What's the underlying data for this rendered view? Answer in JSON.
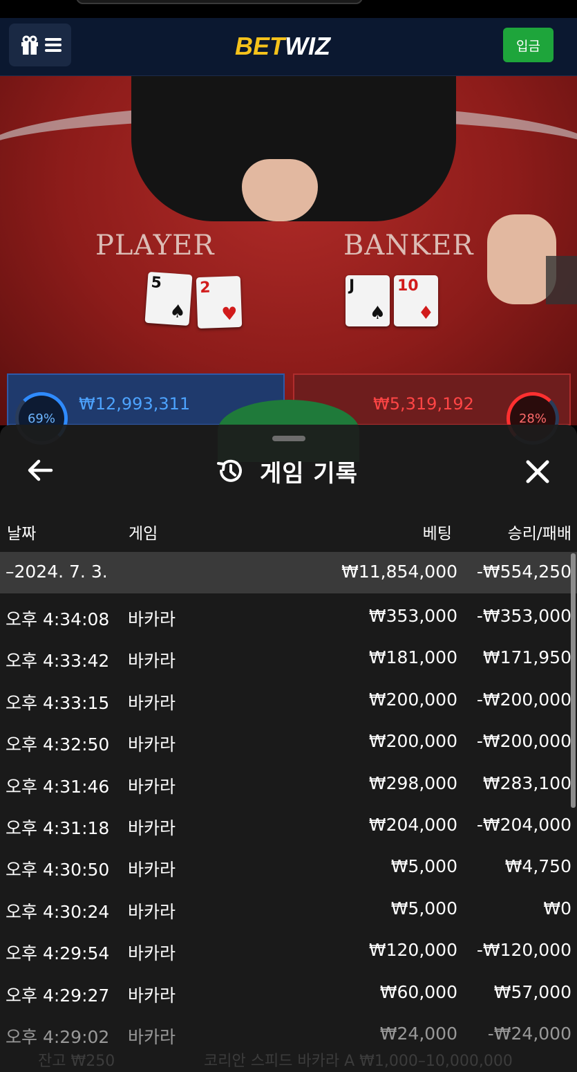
{
  "header": {
    "brand_part1": "BET",
    "brand_part2": "WIZ",
    "deposit_label": "입금"
  },
  "game": {
    "player_label": "PLAYER",
    "banker_label": "BANKER",
    "player_cards": [
      {
        "rank": "5",
        "suit": "♠",
        "color": "black"
      },
      {
        "rank": "2",
        "suit": "♥",
        "color": "red"
      }
    ],
    "banker_cards": [
      {
        "rank": "J",
        "suit": "♠",
        "color": "black"
      },
      {
        "rank": "10",
        "suit": "♦",
        "color": "red"
      }
    ],
    "player_percent": "69%",
    "banker_percent": "28%",
    "player_amount": "₩12,993,311",
    "banker_amount": "₩5,319,192"
  },
  "history": {
    "title": "게임 기록",
    "columns": {
      "date": "날짜",
      "game": "게임",
      "bet": "베팅",
      "result": "승리/패배"
    },
    "summary": {
      "date": "–2024. 7. 3.",
      "bet": "₩11,854,000",
      "result": "-₩554,250"
    },
    "rows": [
      {
        "time": "오후 4:34:08",
        "game": "바카라",
        "bet": "₩353,000",
        "result": "-₩353,000"
      },
      {
        "time": "오후 4:33:42",
        "game": "바카라",
        "bet": "₩181,000",
        "result": "₩171,950"
      },
      {
        "time": "오후 4:33:15",
        "game": "바카라",
        "bet": "₩200,000",
        "result": "-₩200,000"
      },
      {
        "time": "오후 4:32:50",
        "game": "바카라",
        "bet": "₩200,000",
        "result": "-₩200,000"
      },
      {
        "time": "오후 4:31:46",
        "game": "바카라",
        "bet": "₩298,000",
        "result": "₩283,100"
      },
      {
        "time": "오후 4:31:18",
        "game": "바카라",
        "bet": "₩204,000",
        "result": "-₩204,000"
      },
      {
        "time": "오후 4:30:50",
        "game": "바카라",
        "bet": "₩5,000",
        "result": "₩4,750"
      },
      {
        "time": "오후 4:30:24",
        "game": "바카라",
        "bet": "₩5,000",
        "result": "₩0"
      },
      {
        "time": "오후 4:29:54",
        "game": "바카라",
        "bet": "₩120,000",
        "result": "-₩120,000"
      },
      {
        "time": "오후 4:29:27",
        "game": "바카라",
        "bet": "₩60,000",
        "result": "₩57,000"
      },
      {
        "time": "오후 4:29:02",
        "game": "바카라",
        "bet": "₩24,000",
        "result": "-₩24,000"
      }
    ]
  },
  "footer": {
    "balance": "잔고 ₩250",
    "table_name": "코리안 스피드 바카라 A ₩1,000–10,000,000"
  }
}
